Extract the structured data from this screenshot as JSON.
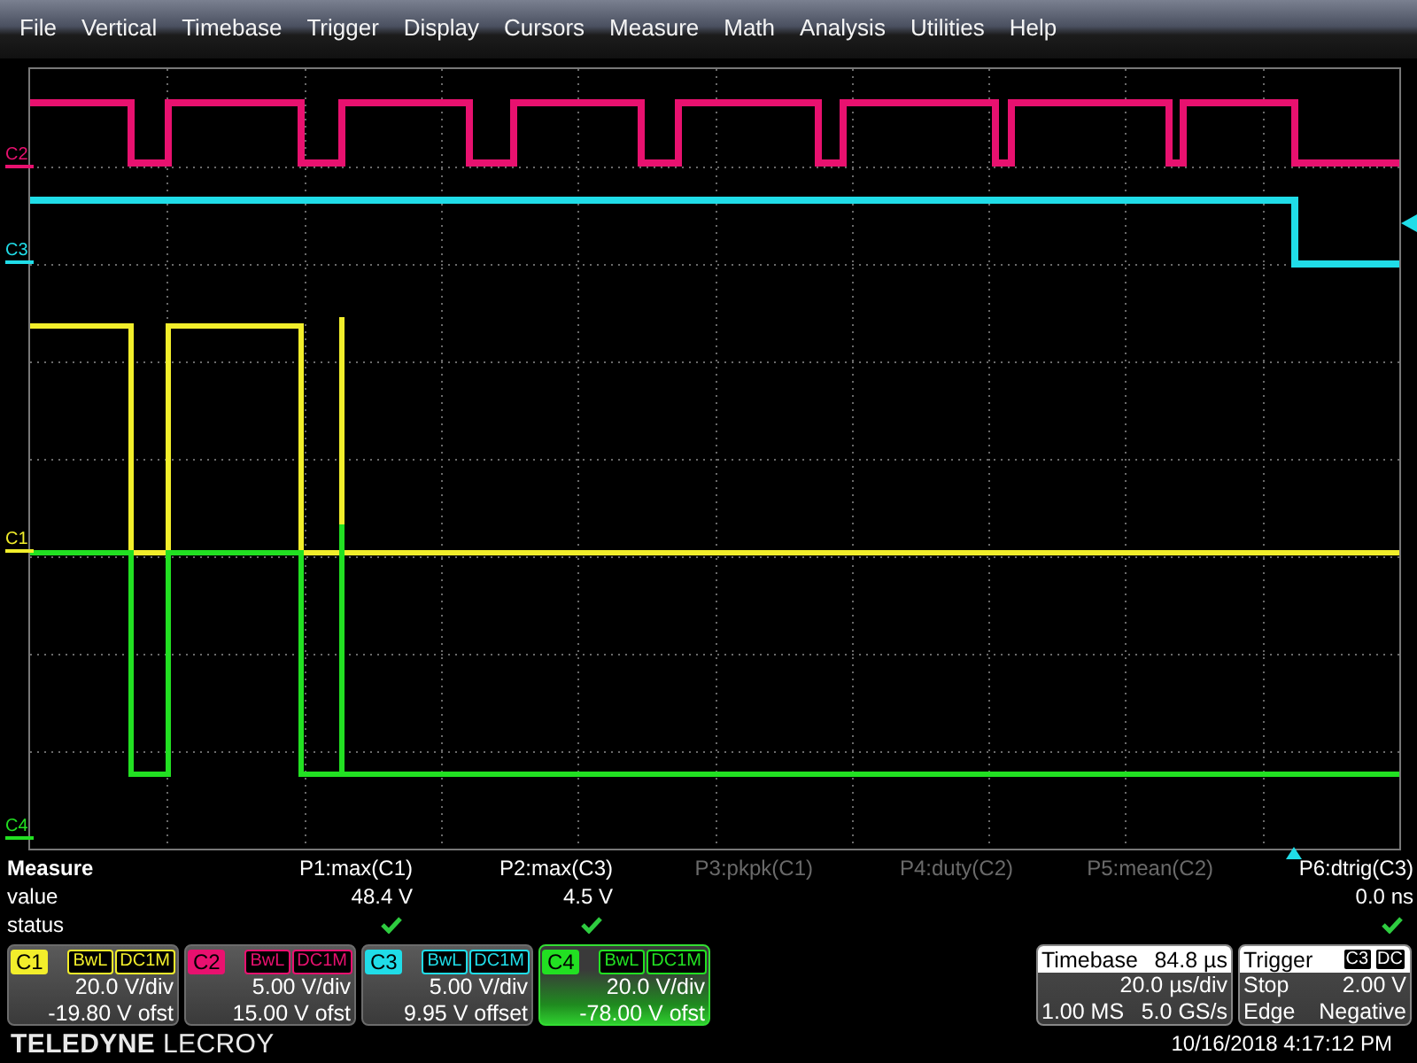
{
  "menu": [
    "File",
    "Vertical",
    "Timebase",
    "Trigger",
    "Display",
    "Cursors",
    "Measure",
    "Math",
    "Analysis",
    "Utilities",
    "Help"
  ],
  "trace_labels": [
    {
      "label": "C2",
      "color": "#e8116f"
    },
    {
      "label": "C3",
      "color": "#20dde8"
    },
    {
      "label": "C1",
      "color": "#f2ee2b"
    },
    {
      "label": "C4",
      "color": "#22e022"
    }
  ],
  "measure": {
    "title": "Measure",
    "row_labels": [
      "value",
      "status"
    ],
    "params": [
      {
        "label": "P1:max(C1)",
        "value": "48.4 V",
        "status_ok": true,
        "active": true
      },
      {
        "label": "P2:max(C3)",
        "value": "4.5 V",
        "status_ok": true,
        "active": true
      },
      {
        "label": "P3:pkpk(C1)",
        "status_ok": false,
        "active": false
      },
      {
        "label": "P4:duty(C2)",
        "status_ok": false,
        "active": false
      },
      {
        "label": "P5:mean(C2)",
        "status_ok": false,
        "active": false
      },
      {
        "label": "P6:dtrig(C3)",
        "value": "0.0 ns",
        "status_ok": true,
        "active": true
      }
    ]
  },
  "channels": [
    {
      "name": "C1",
      "color": "#f2ee2b",
      "bandwidth": "BwL",
      "coupling": "DC1M",
      "scale": "20.0 V/div",
      "offset": "-19.80 V ofst",
      "selected": false
    },
    {
      "name": "C2",
      "color": "#e8116f",
      "bandwidth": "BwL",
      "coupling": "DC1M",
      "scale": "5.00 V/div",
      "offset": "15.00 V ofst",
      "selected": false
    },
    {
      "name": "C3",
      "color": "#20dde8",
      "bandwidth": "BwL",
      "coupling": "DC1M",
      "scale": "5.00 V/div",
      "offset": "9.95 V offset",
      "selected": false
    },
    {
      "name": "C4",
      "color": "#22e022",
      "bandwidth": "BwL",
      "coupling": "DC1M",
      "scale": "20.0 V/div",
      "offset": "-78.00 V ofst",
      "selected": true
    }
  ],
  "timebase": {
    "title": "Timebase",
    "delay": "84.8 µs",
    "scale": "20.0 µs/div",
    "memory": "1.00 MS",
    "sample_rate": "5.0 GS/s"
  },
  "trigger": {
    "title": "Trigger",
    "source": "C3",
    "coupling": "DC",
    "mode": "Stop",
    "trigger_level": "2.00 V",
    "type": "Edge",
    "slope": "Negative"
  },
  "logo": {
    "brand": "TELEDYNE",
    "product": "LECROY"
  },
  "timestamp": "10/16/2018 4:17:12 PM"
}
